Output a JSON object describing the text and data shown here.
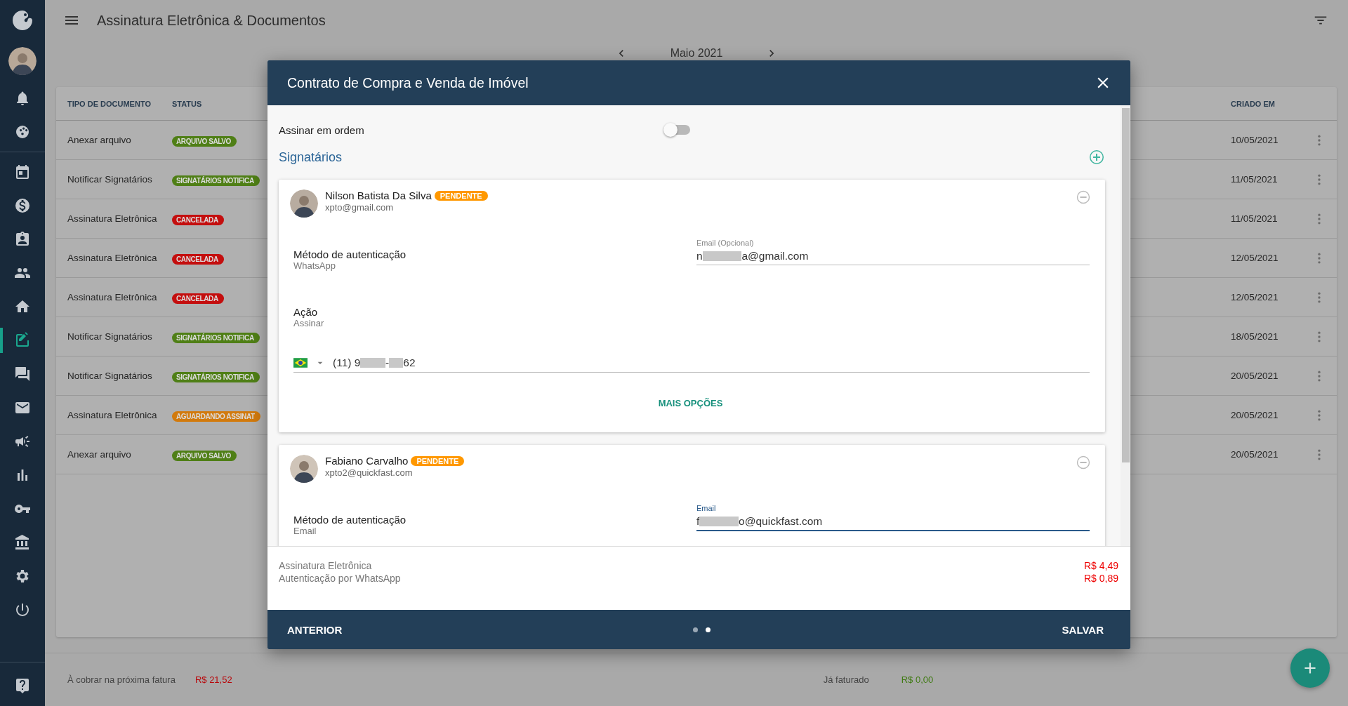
{
  "sidebar": {
    "top": [
      {
        "kind": "bell",
        "selected": false
      },
      {
        "kind": "palette",
        "selected": false
      }
    ],
    "main": [
      {
        "kind": "calendar",
        "selected": false
      },
      {
        "kind": "dollar",
        "selected": false
      },
      {
        "kind": "badge",
        "selected": false
      },
      {
        "kind": "people",
        "selected": false
      },
      {
        "kind": "home",
        "selected": false
      },
      {
        "kind": "edit",
        "selected": true
      },
      {
        "kind": "chat",
        "selected": false
      },
      {
        "kind": "mail",
        "selected": false
      },
      {
        "kind": "megaphone",
        "selected": false
      },
      {
        "kind": "chart",
        "selected": false
      },
      {
        "kind": "key",
        "selected": false
      },
      {
        "kind": "bank",
        "selected": false
      },
      {
        "kind": "gear",
        "selected": false
      },
      {
        "kind": "power",
        "selected": false
      }
    ],
    "bottom": [
      {
        "kind": "help",
        "selected": false
      }
    ]
  },
  "header": {
    "title": "Assinatura Eletrônica & Documentos",
    "month": "Maio 2021"
  },
  "table": {
    "columns": [
      "TIPO DE DOCUMENTO",
      "STATUS",
      "CRIADO EM"
    ],
    "rows": [
      {
        "type": "Anexar arquivo",
        "status": "ARQUIVO SALVO",
        "color": "#4f7f16",
        "created": "10/05/2021"
      },
      {
        "type": "Notificar Signatários",
        "status": "SIGNATÁRIOS NOTIFICA",
        "color": "#4f7f16",
        "created": "11/05/2021"
      },
      {
        "type": "Assinatura Eletrônica",
        "status": "CANCELADA",
        "color": "#c40e0e",
        "created": "11/05/2021"
      },
      {
        "type": "Assinatura Eletrônica",
        "status": "CANCELADA",
        "color": "#c40e0e",
        "created": "12/05/2021"
      },
      {
        "type": "Assinatura Eletrônica",
        "status": "CANCELADA",
        "color": "#c40e0e",
        "created": "12/05/2021"
      },
      {
        "type": "Notificar Signatários",
        "status": "SIGNATÁRIOS NOTIFICA",
        "color": "#4f7f16",
        "created": "18/05/2021"
      },
      {
        "type": "Notificar Signatários",
        "status": "SIGNATÁRIOS NOTIFICA",
        "color": "#4f7f16",
        "created": "20/05/2021"
      },
      {
        "type": "Assinatura Eletrônica",
        "status": "AGUARDANDO ASSINAT",
        "color": "#d27a0d",
        "created": "20/05/2021"
      },
      {
        "type": "Anexar arquivo",
        "status": "ARQUIVO SALVO",
        "color": "#4f7f16",
        "created": "20/05/2021"
      }
    ]
  },
  "billing": {
    "pending_label": "À cobrar na próxima fatura",
    "pending_value": "R$ 21,52",
    "billed_label": "Já faturado",
    "billed_value": "R$ 0,00"
  },
  "modal": {
    "title": "Contrato de Compra e Venda de Imóvel",
    "sign_in_order": {
      "label": "Assinar em ordem",
      "on": false
    },
    "signers_title": "Signatários",
    "signers": [
      {
        "name": "Nilson Batista Da Silva",
        "status": "PENDENTE",
        "email": "xpto@gmail.com",
        "auth_label": "Método de autenticação",
        "auth_value": "WhatsApp",
        "field": {
          "label": "Email (Opcional)",
          "value_parts": [
            "n",
            "a@gmail.com"
          ],
          "focused": false
        },
        "action_label": "Ação",
        "action_value": "Assinar",
        "phone_parts": [
          "(11) 9",
          "-",
          "62"
        ],
        "more": "MAIS OPÇÕES"
      },
      {
        "name": "Fabiano Carvalho",
        "status": "PENDENTE",
        "email": "xpto2@quickfast.com",
        "auth_label": "Método de autenticação",
        "auth_value": "Email",
        "field": {
          "label": "Email",
          "value_parts": [
            "f",
            "o@quickfast.com"
          ],
          "focused": true
        }
      }
    ],
    "costs": [
      {
        "label": "Assinatura Eletrônica",
        "price": "R$ 4,49"
      },
      {
        "label": "Autenticação por WhatsApp",
        "price": "R$ 0,89"
      }
    ],
    "footer": {
      "back": "ANTERIOR",
      "save": "SALVAR",
      "pages": [
        {
          "selected": false
        },
        {
          "selected": true
        }
      ]
    }
  }
}
